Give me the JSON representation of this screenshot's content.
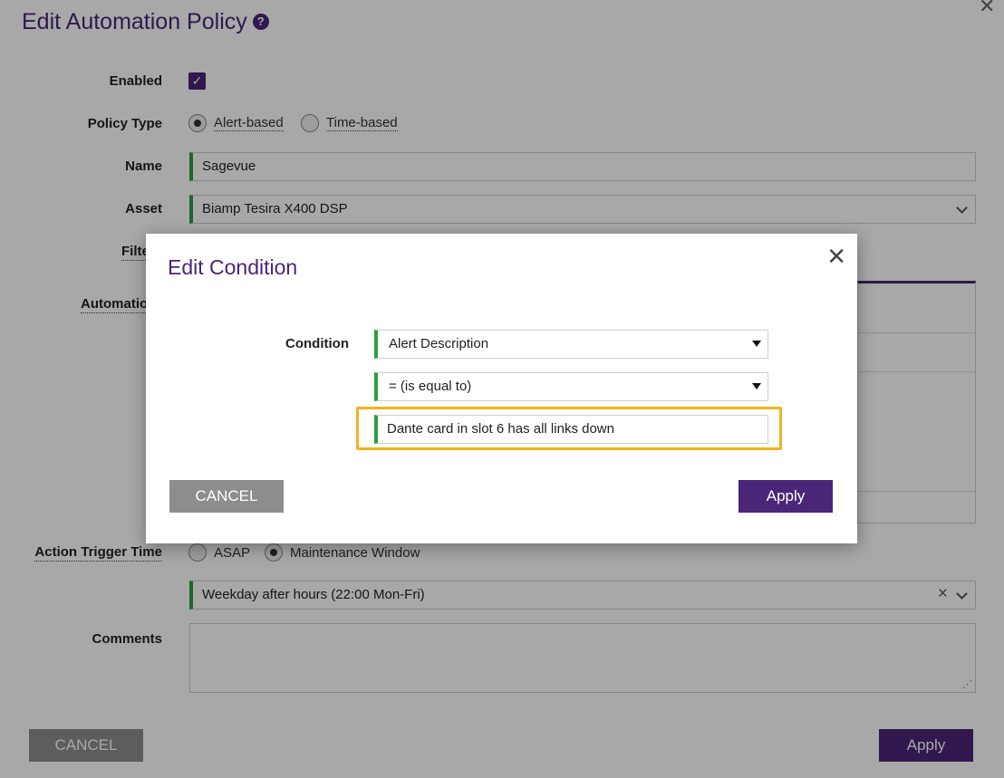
{
  "page": {
    "title": "Edit Automation Policy",
    "help_icon": "question-circle-icon",
    "close_icon": "close-icon"
  },
  "form": {
    "enabled_label": "Enabled",
    "enabled_checked": true,
    "policy_type_label": "Policy Type",
    "policy_type_options": [
      "Alert-based",
      "Time-based"
    ],
    "policy_type_selected": "Alert-based",
    "name_label": "Name",
    "name_value": "Sagevue",
    "asset_label": "Asset",
    "asset_value": "Biamp Tesira X400 DSP",
    "filter_label_partial": "Filte",
    "automation_label_partial": "Automatio",
    "action_trigger_label": "Action Trigger Time",
    "trigger_options": [
      "ASAP",
      "Maintenance Window"
    ],
    "trigger_selected": "Maintenance Window",
    "maintenance_window_value": "Weekday after hours (22:00 Mon-Fri)",
    "comments_label": "Comments",
    "comments_value": "",
    "cancel_label": "CANCEL",
    "apply_label": "Apply"
  },
  "modal": {
    "title": "Edit Condition",
    "condition_label": "Condition",
    "field_select": "Alert Description",
    "operator_select": "= (is equal to)",
    "value_input": "Dante card in slot 6 has all links down",
    "cancel_label": "CANCEL",
    "apply_label": "Apply"
  },
  "colors": {
    "brand_purple": "#4a2578",
    "valid_green": "#2e9e44",
    "focus_amber": "#f4b21c",
    "cancel_gray": "#8d8d8d"
  }
}
